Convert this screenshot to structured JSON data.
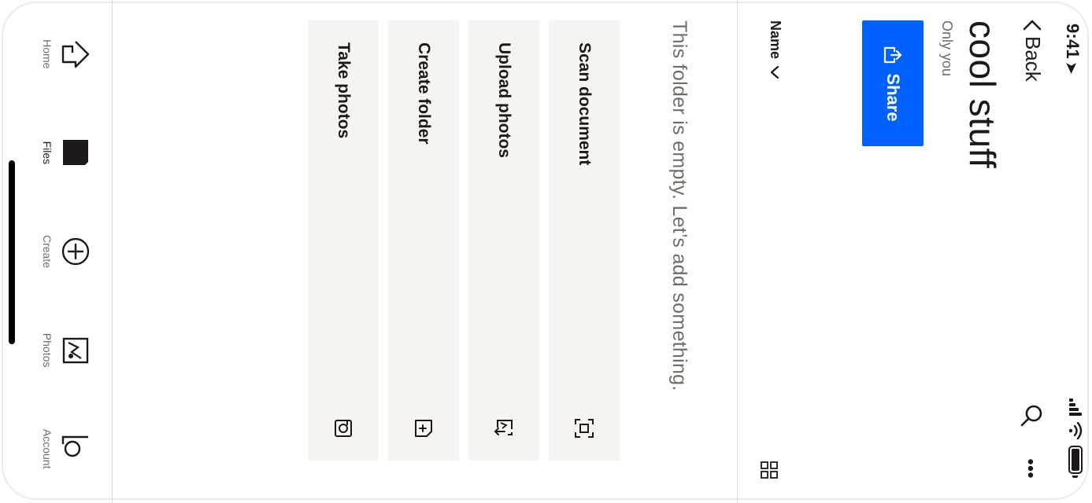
{
  "status": {
    "time": "9:41"
  },
  "nav": {
    "back_label": "Back"
  },
  "folder": {
    "title": "cool stuff",
    "subtitle": "Only you"
  },
  "share": {
    "label": "Share"
  },
  "sort": {
    "label": "Name"
  },
  "empty_message": "This folder is empty. Let’s add something.",
  "actions": [
    {
      "label": "Scan document",
      "icon": "scan-icon"
    },
    {
      "label": "Upload photos",
      "icon": "upload-photos-icon"
    },
    {
      "label": "Create folder",
      "icon": "create-folder-icon"
    },
    {
      "label": "Take photos",
      "icon": "camera-icon"
    }
  ],
  "tabs": [
    {
      "label": "Home",
      "icon": "home-icon",
      "active": false
    },
    {
      "label": "Files",
      "icon": "files-icon",
      "active": true
    },
    {
      "label": "Create",
      "icon": "plus-circle-icon",
      "active": false
    },
    {
      "label": "Photos",
      "icon": "photos-icon",
      "active": false
    },
    {
      "label": "Account",
      "icon": "account-icon",
      "active": false
    }
  ],
  "colors": {
    "accent": "#0061fe",
    "text": "#1e1919",
    "muted": "#736c64",
    "tile": "#f5f4f0"
  }
}
